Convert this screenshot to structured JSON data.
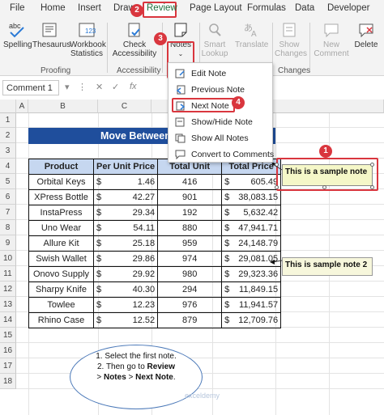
{
  "tabs": [
    "File",
    "Home",
    "Insert",
    "Draw",
    "Review",
    "Page Layout",
    "Formulas",
    "Data",
    "Developer"
  ],
  "badges": {
    "b1": "1",
    "b2": "2",
    "b3": "3",
    "b4": "4"
  },
  "ribbon": {
    "spelling": "Spelling",
    "thesaurus": "Thesaurus",
    "workbook_stats": "Workbook Statistics",
    "check_access": "Check Accessibility",
    "notes": "Notes",
    "smart_lookup": "Smart Lookup",
    "translate": "Translate",
    "show_changes": "Show Changes",
    "new_comment": "New Comment",
    "delete": "Delete",
    "proofing_group": "Proofing",
    "accessibility_group": "Accessibility",
    "changes_group": "Changes"
  },
  "formula_bar": {
    "name_box": "Comment 1",
    "fx": "fx"
  },
  "columns": [
    "A",
    "B",
    "C"
  ],
  "rows": [
    "1",
    "2",
    "3",
    "4",
    "5",
    "6",
    "7",
    "8",
    "9",
    "10",
    "11",
    "12",
    "13",
    "14",
    "15",
    "16",
    "17",
    "18"
  ],
  "title_text": "Move Between",
  "table": {
    "headers": [
      "Product",
      "Per Unit Price",
      "Total Unit",
      "Total Price"
    ],
    "currency": "$",
    "rows": [
      [
        "Orbital Keys",
        "1.46",
        "416",
        "605.49"
      ],
      [
        "XPress Bottle",
        "42.27",
        "901",
        "38,083.15"
      ],
      [
        "InstaPress",
        "29.34",
        "192",
        "5,632.42"
      ],
      [
        "Uno Wear",
        "54.11",
        "880",
        "47,941.71"
      ],
      [
        "Allure Kit",
        "25.18",
        "959",
        "24,148.79"
      ],
      [
        "Swish Wallet",
        "29.86",
        "974",
        "29,081.05"
      ],
      [
        "Onovo Supply",
        "29.92",
        "980",
        "29,323.36"
      ],
      [
        "Sharpy Knife",
        "40.30",
        "294",
        "11,849.15"
      ],
      [
        "Towlee",
        "12.23",
        "976",
        "11,941.57"
      ],
      [
        "Rhino Case",
        "12.52",
        "879",
        "12,709.76"
      ]
    ]
  },
  "notes_menu": {
    "edit": "Edit Note",
    "previous": "Previous Note",
    "next": "Next Note",
    "show_hide": "Show/Hide Note",
    "show_all": "Show All Notes",
    "convert": "Convert to Comments"
  },
  "note1": "This is a sample note",
  "note2": "This is sample note 2",
  "callout": {
    "line1": "1. Select the first note.",
    "line2": "2. Then go to",
    "review": "Review",
    "sep": ">",
    "notes": "Notes",
    "next": "Next Note",
    "end": "."
  },
  "watermark": "exceldemy",
  "colors": {
    "accent_red": "#d9363e",
    "title_blue": "#1f4e9c",
    "header_blue": "#c6d7f0",
    "note_yellow": "#f5f7c8"
  }
}
